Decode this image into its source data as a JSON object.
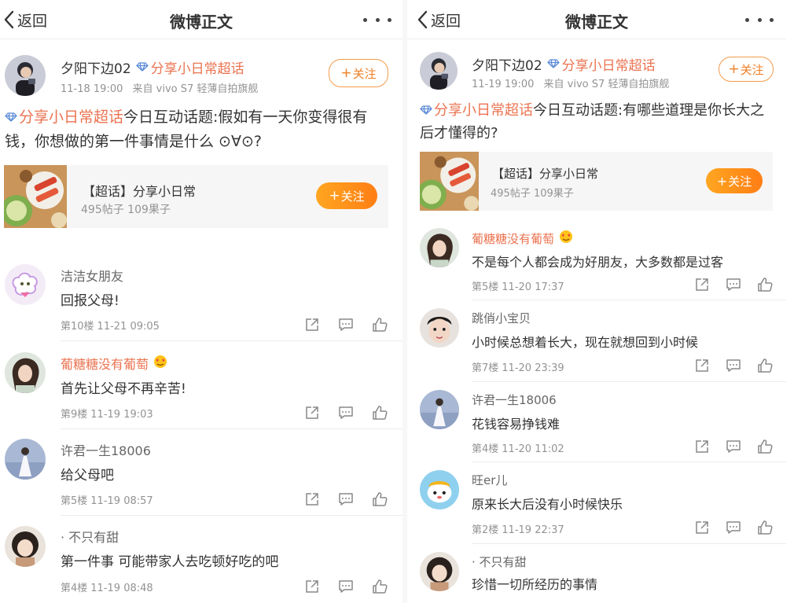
{
  "nav": {
    "back_label": "返回",
    "title": "微博正文"
  },
  "colors": {
    "accent": "#eb7350",
    "follow": "#ff8a15",
    "text": "#333333",
    "meta": "#939393"
  },
  "left": {
    "post": {
      "author": "夕阳下边02",
      "topic": "分享小日常超话",
      "time": "11-18 19:00",
      "source": "来自 vivo S7 轻薄自拍旗舰",
      "follow_label": "关注",
      "text_topic": "分享小日常超话",
      "text_body": "今日互动话题:假如有一天你变得很有钱，你想做的第一件事情是什么 ⊙∀⊙?"
    },
    "card": {
      "name": "【超话】分享小日常",
      "stats": "495帖子 109果子",
      "follow_label": "关注"
    },
    "comments": [
      {
        "name": "洁洁女朋友",
        "vip": false,
        "text": "回报父母!",
        "floor": "第10楼",
        "time": "11-21 09:05"
      },
      {
        "name": "葡糖糖没有葡萄",
        "vip": true,
        "text": "首先让父母不再辛苦!",
        "floor": "第9楼",
        "time": "11-19 19:03"
      },
      {
        "name": "许君一生18006",
        "vip": false,
        "text": "给父母吧",
        "floor": "第5楼",
        "time": "11-19 08:57"
      },
      {
        "name": "· 不只有甜",
        "vip": false,
        "text": "第一件事 可能带家人去吃顿好吃的吧",
        "floor": "第4楼",
        "time": "11-19 08:48"
      }
    ]
  },
  "right": {
    "post": {
      "author": "夕阳下边02",
      "topic": "分享小日常超话",
      "time": "11-19 19:00",
      "source": "来自 vivo S7 轻薄自拍旗舰",
      "follow_label": "关注",
      "text_topic": "分享小日常超话",
      "text_body": "今日互动话题:有哪些道理是你长大之后才懂得的?"
    },
    "card": {
      "name": "【超话】分享小日常",
      "stats": "495帖子 109果子",
      "follow_label": "关注"
    },
    "comments": [
      {
        "name": "葡糖糖没有葡萄",
        "vip": true,
        "text": "不是每个人都会成为好朋友，大多数都是过客",
        "floor": "第5楼",
        "time": "11-20 17:37"
      },
      {
        "name": "跳俏小宝贝",
        "vip": false,
        "text": "小时候总想着长大，现在就想回到小时候",
        "floor": "第7楼",
        "time": "11-20 23:39"
      },
      {
        "name": "许君一生18006",
        "vip": false,
        "text": "花钱容易挣钱难",
        "floor": "第4楼",
        "time": "11-20 11:02"
      },
      {
        "name": "旺er儿",
        "vip": false,
        "text": "原来长大后没有小时候快乐",
        "floor": "第2楼",
        "time": "11-19 22:37"
      },
      {
        "name": "· 不只有甜",
        "vip": false,
        "text": "珍惜一切所经历的事情",
        "floor": "",
        "time": ""
      }
    ]
  }
}
